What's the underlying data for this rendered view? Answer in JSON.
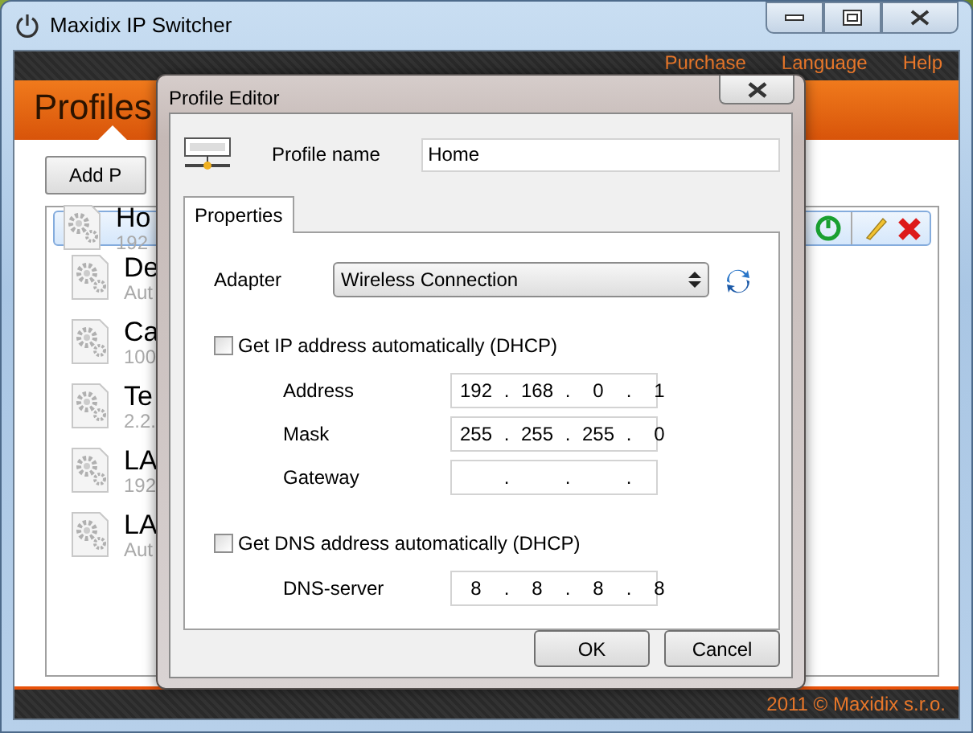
{
  "window": {
    "title": "Maxidix IP Switcher"
  },
  "menu": [
    "Purchase",
    "Language",
    "Help"
  ],
  "header": {
    "title": "Profiles"
  },
  "toolbar": {
    "add_button": "Add P"
  },
  "profiles": [
    {
      "name": "Ho",
      "detail": "192",
      "selected": true
    },
    {
      "name": "De",
      "detail": "Aut",
      "selected": false
    },
    {
      "name": "Ca",
      "detail": "100",
      "selected": false
    },
    {
      "name": "Te",
      "detail": "2.2.",
      "selected": false
    },
    {
      "name": "LA",
      "detail": "192",
      "selected": false
    },
    {
      "name": "LA",
      "detail": "Aut",
      "selected": false
    }
  ],
  "footer": "2011 © Maxidix s.r.o.",
  "dialog": {
    "title": "Profile Editor",
    "profile_name": {
      "label": "Profile name",
      "value": "Home"
    },
    "tabs": [
      {
        "label": "Properties",
        "selected": true
      }
    ],
    "adapter": {
      "label": "Adapter",
      "value": "Wireless Connection"
    },
    "dhcp_ip": {
      "label": "Get IP address automatically (DHCP)",
      "checked": false
    },
    "ip_fields": [
      {
        "label": "Address",
        "octets": [
          "192",
          "168",
          "0",
          "1"
        ],
        "dots": [
          ".",
          ".",
          "."
        ]
      },
      {
        "label": "Mask",
        "octets": [
          "255",
          "255",
          "255",
          "0"
        ],
        "dots": [
          ".",
          ".",
          "."
        ]
      },
      {
        "label": "Gateway",
        "dots": [
          ".",
          ".",
          "."
        ]
      }
    ],
    "dhcp_dns": {
      "label": "Get DNS address automatically (DHCP)",
      "checked": false
    },
    "dns_fields": [
      {
        "label": "DNS-server",
        "octets": [
          "8",
          "8",
          "8",
          "8"
        ],
        "dots": [
          ".",
          ".",
          "."
        ]
      }
    ],
    "buttons": [
      "OK",
      "Cancel"
    ]
  }
}
